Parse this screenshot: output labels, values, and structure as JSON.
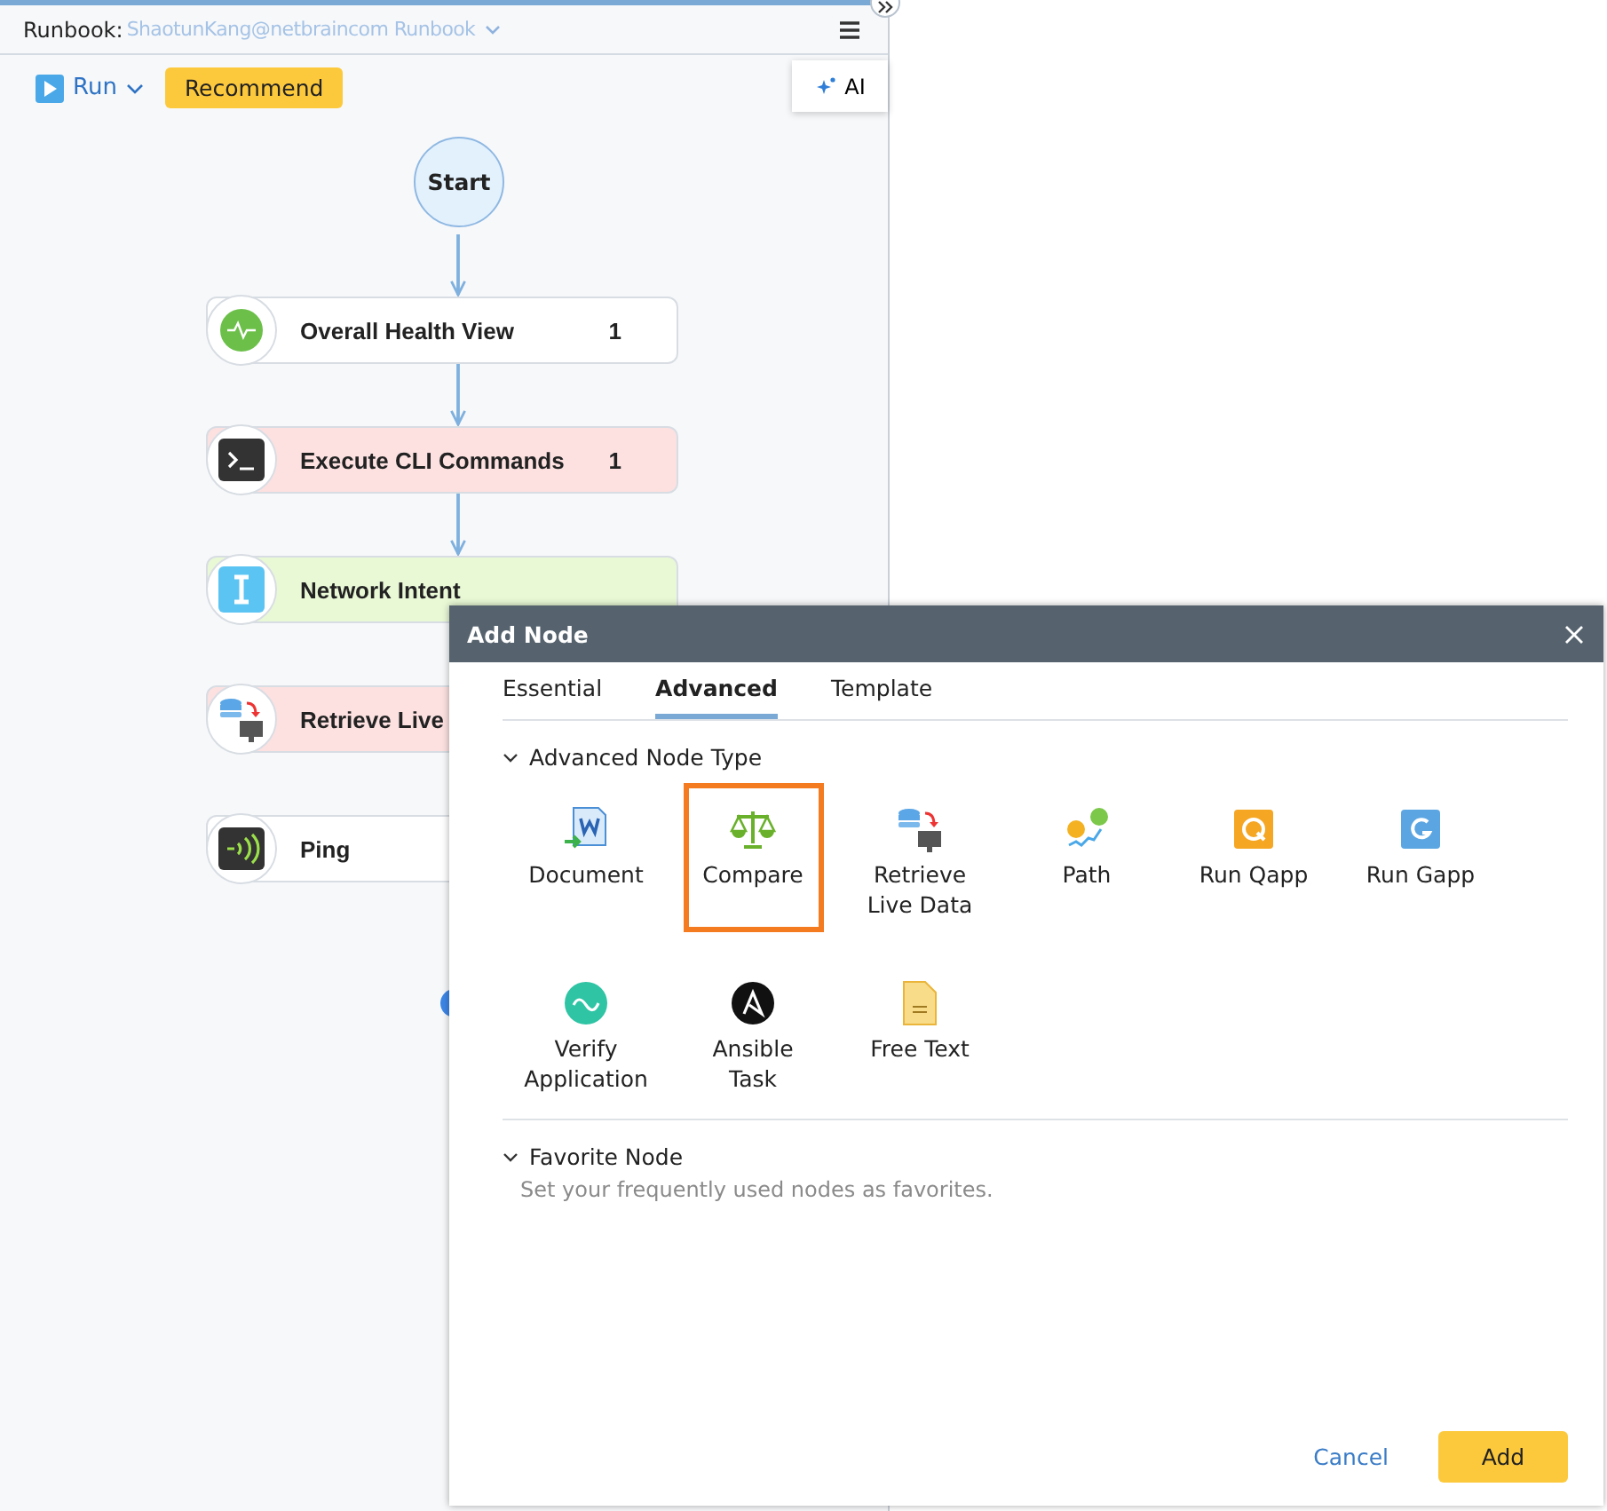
{
  "runbook": {
    "label": "Runbook:",
    "name": "ShaotunKang@netbraincom Runbook"
  },
  "toolbar": {
    "run": "Run",
    "recommend": "Recommend",
    "ai": "AI"
  },
  "flow": {
    "start": "Start",
    "nodes": [
      {
        "kind": "health",
        "label": "Overall Health View",
        "count": "1",
        "color": "#ffffff",
        "linked": true
      },
      {
        "kind": "cli",
        "label": "Execute CLI Commands",
        "count": "1",
        "color": "#fde1e1",
        "linked": true
      },
      {
        "kind": "intent",
        "label": "Network Intent",
        "color": "#e9f9d6",
        "linked": true
      },
      {
        "kind": "retrieve",
        "label": "Retrieve Live",
        "color": "#fde1e1",
        "linked": false
      },
      {
        "kind": "ping",
        "label": "Ping",
        "color": "#ffffff",
        "linked": false
      }
    ]
  },
  "dialog": {
    "title": "Add Node",
    "tabs": [
      {
        "label": "Essential",
        "selected": false
      },
      {
        "label": "Advanced",
        "selected": true
      },
      {
        "label": "Template",
        "selected": false
      }
    ],
    "section": "Advanced Node Type",
    "items": [
      {
        "kind": "document",
        "label": "Document",
        "selected": false
      },
      {
        "kind": "compare",
        "label": "Compare",
        "selected": true
      },
      {
        "kind": "retrieve",
        "label": "Retrieve Live Data",
        "selected": false
      },
      {
        "kind": "path",
        "label": "Path",
        "selected": false
      },
      {
        "kind": "qapp",
        "label": "Run Qapp",
        "selected": false
      },
      {
        "kind": "gapp",
        "label": "Run Gapp",
        "selected": false
      },
      {
        "kind": "verify",
        "label": "Verify Application",
        "selected": false
      },
      {
        "kind": "ansible",
        "label": "Ansible Task",
        "selected": false
      },
      {
        "kind": "freetext",
        "label": "Free Text",
        "selected": false
      }
    ],
    "favorites": {
      "title": "Favorite Node",
      "hint": "Set your frequently used nodes as favorites."
    },
    "cancel": "Cancel",
    "add": "Add"
  }
}
